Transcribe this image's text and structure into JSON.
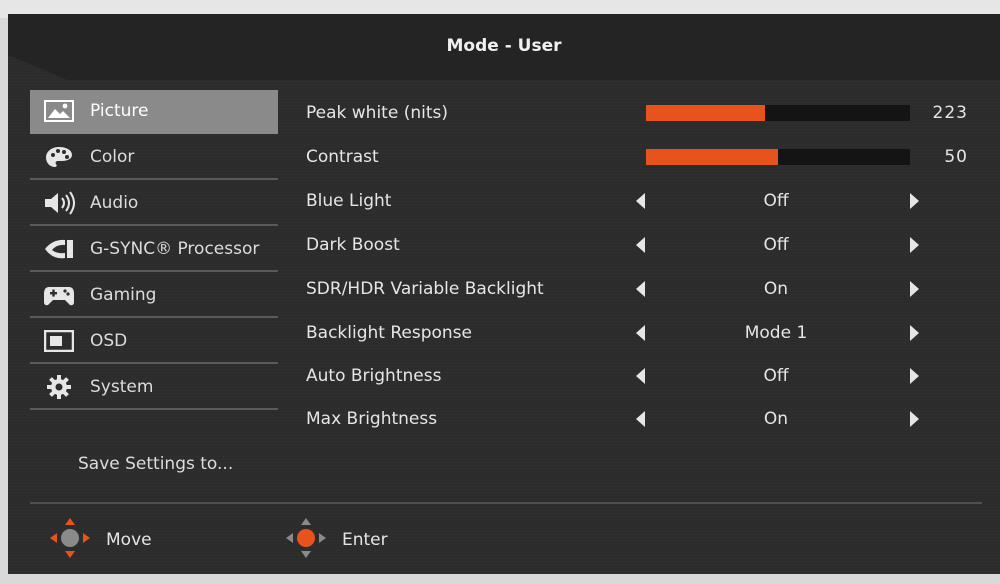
{
  "window": {
    "title": "Mode - User"
  },
  "sidebar": {
    "items": [
      {
        "label": "Picture",
        "icon": "picture-icon",
        "active": true
      },
      {
        "label": "Color",
        "icon": "palette-icon"
      },
      {
        "label": "Audio",
        "icon": "speaker-icon"
      },
      {
        "label": "G-SYNC® Processor",
        "icon": "nvidia-icon"
      },
      {
        "label": "Gaming",
        "icon": "gamepad-icon"
      },
      {
        "label": "OSD",
        "icon": "osd-icon"
      },
      {
        "label": "System",
        "icon": "gear-icon"
      }
    ],
    "save_label": "Save Settings to..."
  },
  "settings": {
    "peak_white": {
      "label": "Peak white (nits)",
      "value": "223",
      "level": 0.45
    },
    "contrast": {
      "label": "Contrast",
      "value": "50",
      "level": 0.5
    },
    "options": [
      {
        "label": "Blue Light",
        "value": "Off"
      },
      {
        "label": "Dark Boost",
        "value": "Off"
      },
      {
        "label": "SDR/HDR Variable Backlight",
        "value": "On"
      },
      {
        "label": "Backlight Response",
        "value": "Mode 1"
      },
      {
        "label": "Auto Brightness",
        "value": "Off"
      },
      {
        "label": "Max Brightness",
        "value": "On"
      }
    ]
  },
  "footer": {
    "move_label": "Move",
    "enter_label": "Enter"
  },
  "colors": {
    "accent": "#e8531c",
    "background": "#2c2c2c",
    "active_item": "#8a8a8a"
  }
}
